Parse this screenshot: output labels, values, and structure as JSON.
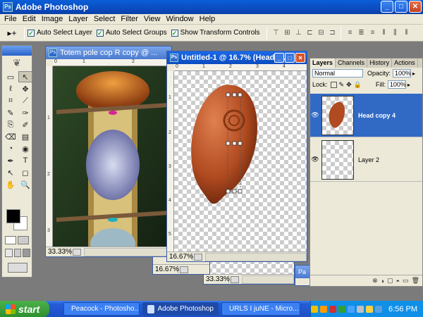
{
  "app": {
    "title": "Adobe Photoshop"
  },
  "window_controls": {
    "minimize": "_",
    "maximize": "□",
    "close": "✕"
  },
  "menu": [
    "File",
    "Edit",
    "Image",
    "Layer",
    "Select",
    "Filter",
    "View",
    "Window",
    "Help"
  ],
  "options_bar": {
    "tool_symbol": "▸+",
    "checkboxes": [
      {
        "label": "Auto Select Layer",
        "checked": true
      },
      {
        "label": "Auto Select Groups",
        "checked": true
      },
      {
        "label": "Show Transform Controls",
        "checked": true
      }
    ]
  },
  "toolbox": {
    "tools": [
      "▭",
      "↖",
      "ℓ",
      "✥",
      "⌗",
      "⟋",
      "✎",
      "✑",
      "⎘",
      "✐",
      "⌫",
      "▤",
      "◔",
      "◉",
      "✒",
      "T",
      "↖",
      "◻",
      "✋",
      "🔍"
    ]
  },
  "documents": {
    "totem": {
      "title": "Totem pole cop    R copy @ ...",
      "zoom": "33.33%",
      "ruler_h": [
        "0",
        "1",
        "2"
      ],
      "ruler_v": [
        "1",
        "2",
        "3"
      ]
    },
    "untitled": {
      "title": "Untitled-1 @ 16.7% (Head c...",
      "zoom": "16.67%",
      "ruler_h": [
        "0",
        "1",
        "2",
        "3",
        "4"
      ],
      "ruler_v": [
        "1",
        "2",
        "3",
        "4",
        "5"
      ]
    },
    "back1": {
      "zoom": "16.67%"
    },
    "back2": {
      "zoom": "33.33%"
    },
    "back3": {
      "title": "Pa"
    }
  },
  "layers_panel": {
    "tabs": [
      "Layers",
      "Channels",
      "History",
      "Actions"
    ],
    "blend_mode": "Normal",
    "opacity_label": "Opacity:",
    "opacity_value": "100%",
    "lock_label": "Lock:",
    "fill_label": "Fill:",
    "fill_value": "100%",
    "layers": [
      {
        "name": "Head copy 4",
        "active": true,
        "visible": true
      },
      {
        "name": "Layer 2",
        "active": false,
        "visible": true
      }
    ],
    "eye_symbol": "👁",
    "footer_icons": [
      "⊗",
      "◑",
      "▢",
      "◓",
      "▭",
      "🗑"
    ]
  },
  "taskbar": {
    "start": "start",
    "tasks": [
      {
        "label": "Peacock - Photosho...",
        "active": false
      },
      {
        "label": "Adobe Photoshop",
        "active": true
      },
      {
        "label": "URLS I juNE - Micro...",
        "active": false
      }
    ],
    "clock": "6:56 PM",
    "tray_colors": [
      "#f0c000",
      "#ff9a00",
      "#d03030",
      "#30a030",
      "#4aa0ff",
      "#c0c0c0",
      "#ffd040",
      "#5a9fe0"
    ]
  }
}
